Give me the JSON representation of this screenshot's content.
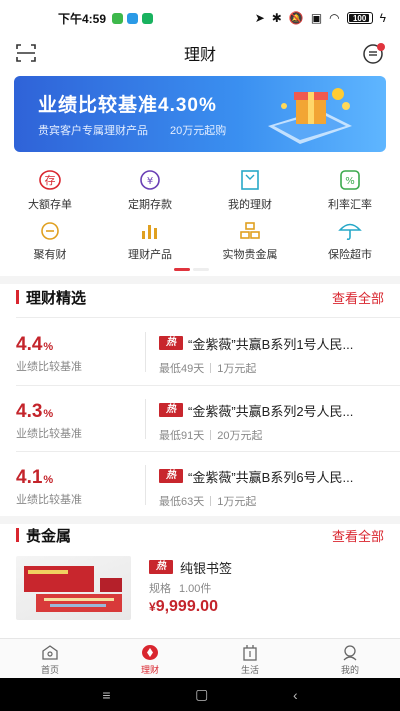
{
  "status_bar": {
    "time": "下午4:59",
    "battery": "100"
  },
  "header": {
    "title": "理财"
  },
  "banner": {
    "headline": "业绩比较基准",
    "rate": "4.30%",
    "sub_left": "贵宾客户专属理财产品",
    "sub_right": "20万元起购"
  },
  "quick_menu": [
    [
      {
        "label": "大额存单",
        "icon": "deposit-icon"
      },
      {
        "label": "定期存款",
        "icon": "fixed-deposit-icon"
      },
      {
        "label": "我的理财",
        "icon": "my-wealth-icon"
      },
      {
        "label": "利率汇率",
        "icon": "rate-icon"
      }
    ],
    [
      {
        "label": "聚有财",
        "icon": "gold-pot-icon"
      },
      {
        "label": "理财产品",
        "icon": "chart-icon"
      },
      {
        "label": "实物贵金属",
        "icon": "gold-bars-icon"
      },
      {
        "label": "保险超市",
        "icon": "umbrella-icon"
      }
    ]
  ],
  "wealth_section": {
    "title": "理财精选",
    "more": "查看全部",
    "hot_badge": "热",
    "products": [
      {
        "rate": "4.4",
        "unit": "%",
        "rate_label": "业绩比较基准",
        "name": "“金紫薇”共赢B系列1号人民...",
        "term": "最低49天",
        "min": "1万元起"
      },
      {
        "rate": "4.3",
        "unit": "%",
        "rate_label": "业绩比较基准",
        "name": "“金紫薇”共赢B系列2号人民...",
        "term": "最低91天",
        "min": "20万元起"
      },
      {
        "rate": "4.1",
        "unit": "%",
        "rate_label": "业绩比较基准",
        "name": "“金紫薇”共赢B系列6号人民...",
        "term": "最低63天",
        "min": "1万元起"
      }
    ]
  },
  "metal_section": {
    "title": "贵金属",
    "more": "查看全部",
    "hot_badge": "热",
    "item": {
      "name": "纯银书签",
      "spec_label": "规格",
      "spec_value": "1.00件",
      "currency": "¥",
      "price": "9,999.00"
    }
  },
  "tabs": [
    {
      "label": "首页",
      "icon": "home-icon",
      "active": false
    },
    {
      "label": "理财",
      "icon": "wealth-icon",
      "active": true
    },
    {
      "label": "生活",
      "icon": "life-icon",
      "active": false
    },
    {
      "label": "我的",
      "icon": "profile-icon",
      "active": false
    }
  ],
  "colors": {
    "accent": "#d9262f",
    "banner_start": "#2f63d8",
    "banner_end": "#5fb6ff"
  }
}
